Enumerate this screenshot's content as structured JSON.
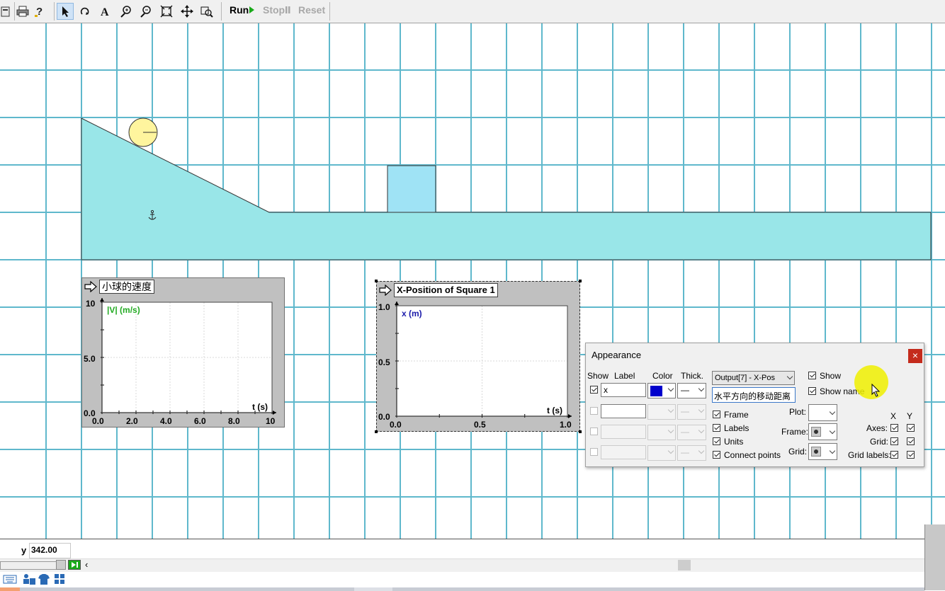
{
  "toolbar": {
    "run_label": "Run",
    "stop_label": "Stop",
    "reset_label": "Reset"
  },
  "graph1": {
    "title": "小球的速度",
    "ylabel": "|V| (m/s)",
    "xlabel": "t (s)",
    "yticks": [
      "10",
      "5.0",
      "0.0"
    ],
    "xticks": [
      "0.0",
      "2.0",
      "4.0",
      "6.0",
      "8.0",
      "10"
    ]
  },
  "graph2": {
    "title": "X-Position of Square 1",
    "ylabel": "x (m)",
    "xlabel": "t (s)",
    "yticks": [
      "1.0",
      "0.5",
      "0.0"
    ],
    "xticks": [
      "0.0",
      "0.5",
      "1.0"
    ]
  },
  "chart_data": [
    {
      "type": "line",
      "title": "小球的速度",
      "xlabel": "t (s)",
      "ylabel": "|V| (m/s)",
      "xlim": [
        0,
        10
      ],
      "ylim": [
        0,
        10
      ],
      "x_ticks": [
        "0.0",
        "2.0",
        "4.0",
        "6.0",
        "8.0",
        "10"
      ],
      "y_ticks": [
        "0.0",
        "5.0",
        "10"
      ],
      "grid": true,
      "series": []
    },
    {
      "type": "line",
      "title": "X-Position of Square 1",
      "xlabel": "t (s)",
      "ylabel": "x (m)",
      "xlim": [
        0,
        1.0
      ],
      "ylim": [
        0,
        1.0
      ],
      "x_ticks": [
        "0.0",
        "0.5",
        "1.0"
      ],
      "y_ticks": [
        "0.0",
        "0.5",
        "1.0"
      ],
      "grid": true,
      "series": []
    }
  ],
  "appearance": {
    "title": "Appearance",
    "close": "×",
    "col_show": "Show",
    "col_label": "Label",
    "col_color": "Color",
    "col_thick": "Thick.",
    "row1_label_value": "x",
    "row1_color": "#0000cc",
    "thick_symbol": "—",
    "output_select": "Output[7] - X-Pos",
    "name_value": "水平方向的移动距离",
    "show_label": "Show",
    "show_name_label": "Show name",
    "frame_label": "Frame",
    "labels_label": "Labels",
    "units_label": "Units",
    "connect_label": "Connect points",
    "plot_label": "Plot:",
    "frame_sel_label": "Frame:",
    "grid_sel_label": "Grid:",
    "col_x": "X",
    "col_y": "Y",
    "axes_label": "Axes:",
    "grid_label": "Grid:",
    "gridlabels_label": "Grid labels:"
  },
  "status": {
    "coord_label": "y",
    "coord_value": "342.00"
  },
  "colors": {
    "ground": "#99e6e8",
    "block": "#9fe3f5",
    "ball": "#fff59e",
    "grid": "#5fb8cc",
    "series_green": "#22aa22",
    "series_blue": "#1a1aaa"
  }
}
